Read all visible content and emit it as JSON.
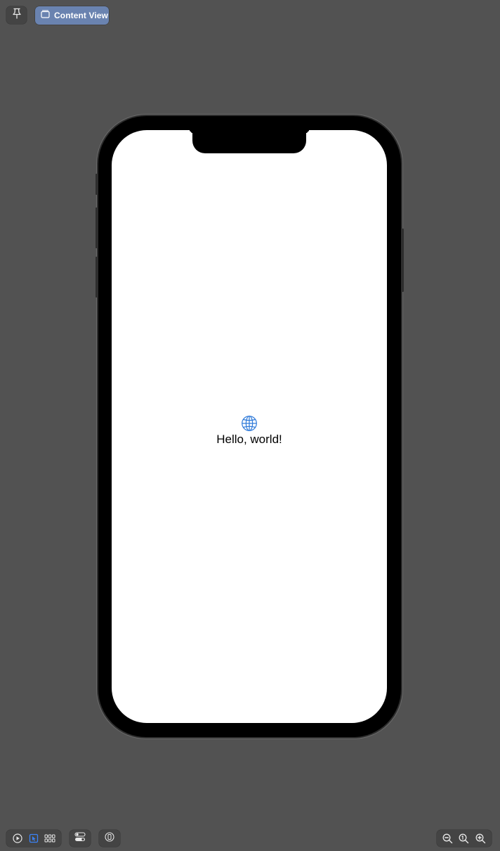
{
  "toolbar": {
    "pin_icon": "pin-icon",
    "preview_tab": {
      "label": "Content View",
      "icon": "window-icon",
      "color": "#6a83b0"
    }
  },
  "device": {
    "screen": {
      "icon": "globe-icon",
      "icon_color": "#2f7ad9",
      "text": "Hello, world!"
    }
  },
  "bottom_toolbar": {
    "modes": [
      {
        "icon": "live-play-icon",
        "selected": false
      },
      {
        "icon": "selectable-cursor-icon",
        "selected": true
      },
      {
        "icon": "variants-grid-icon",
        "selected": false
      }
    ],
    "device_settings_icon": "device-settings-toggle-icon",
    "device_picker_icon": "device-icon",
    "zoom": [
      {
        "icon": "zoom-out-icon"
      },
      {
        "icon": "zoom-to-fit-icon"
      },
      {
        "icon": "zoom-in-icon"
      }
    ],
    "accent_color": "#3b82f6"
  }
}
